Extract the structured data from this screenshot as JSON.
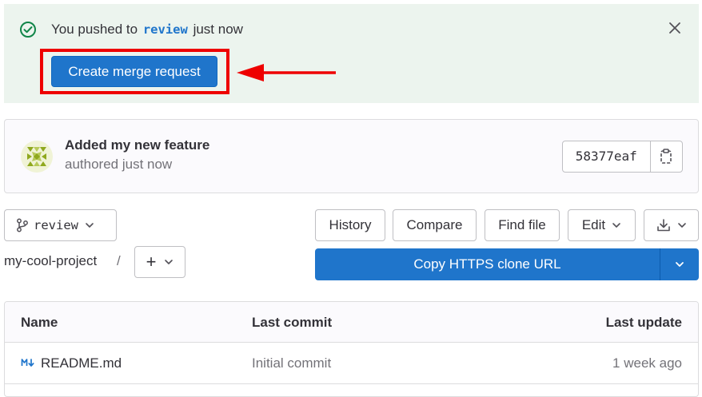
{
  "alert": {
    "prefix": "You pushed to",
    "branch": "review",
    "suffix": "just now",
    "create_mr_label": "Create merge request",
    "icons": [
      "check-circle-icon",
      "close-icon"
    ],
    "highlight_color": "#ee0000"
  },
  "commit": {
    "title": "Added my new feature",
    "authored": "authored just now",
    "sha": "58377eaf",
    "icons": [
      "avatar",
      "copy-icon"
    ]
  },
  "toolbar": {
    "branch_label": "review",
    "history_label": "History",
    "compare_label": "Compare",
    "find_file_label": "Find file",
    "edit_label": "Edit",
    "icons": [
      "branch-icon",
      "chevron-down-icon",
      "download-icon"
    ]
  },
  "breadcrumb": {
    "project": "my-cool-project",
    "separator": "/",
    "add_label": "+"
  },
  "clone": {
    "label": "Copy HTTPS clone URL",
    "color": "#1f75cb"
  },
  "table": {
    "columns": [
      "Name",
      "Last commit",
      "Last update"
    ],
    "rows": [
      {
        "name": "README.md",
        "last_commit": "Initial commit",
        "last_update": "1 week ago",
        "icon": "markdown-icon"
      }
    ]
  }
}
